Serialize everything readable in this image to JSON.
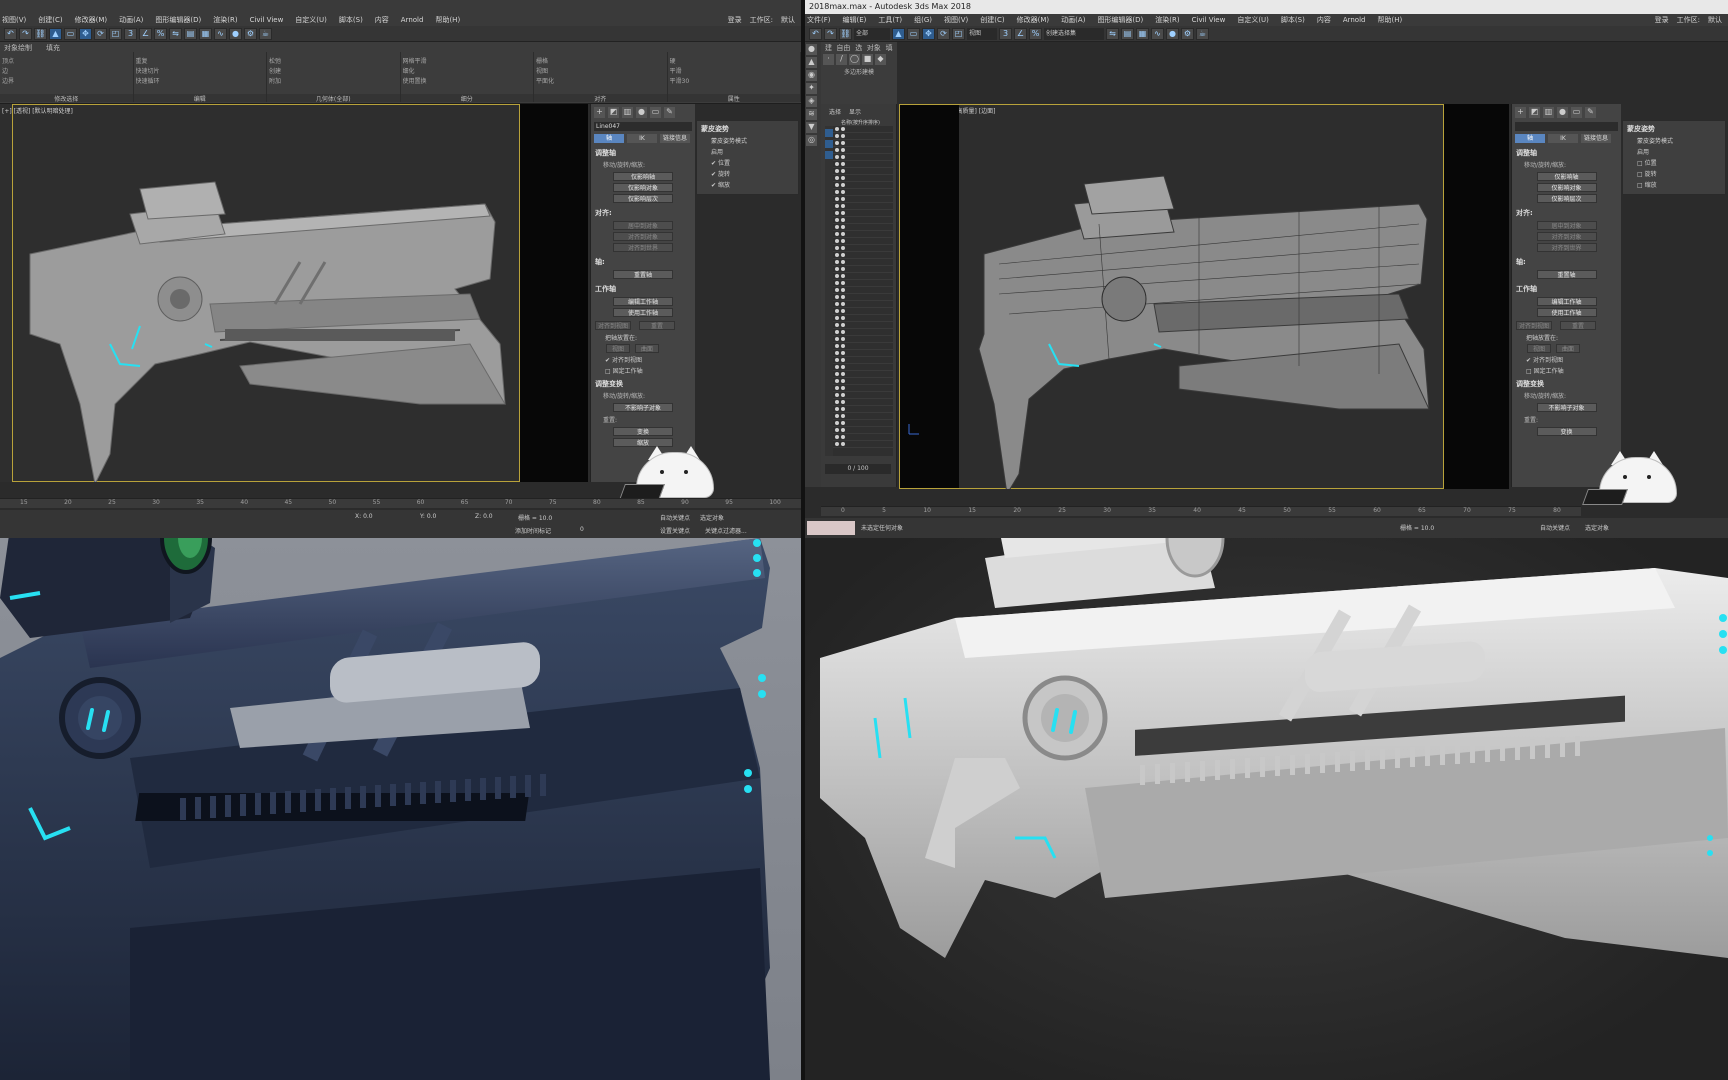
{
  "left_window": {
    "title": "",
    "menu": [
      "视图(V)",
      "创建(C)",
      "修改器(M)",
      "动画(A)",
      "图形编辑器(D)",
      "渲染(R)",
      "Civil View",
      "自定义(U)",
      "脚本(S)",
      "内容",
      "Arnold",
      "帮助(H)"
    ],
    "menu_right": {
      "login": "登录",
      "workspace": "工作区:",
      "workspace_val": "默认"
    },
    "ribbon_tabs": [
      "对象绘制",
      "填充"
    ],
    "ribbon_groups": [
      {
        "label": "修改选择",
        "rows": [
          "顶点",
          "边",
          "边界"
        ]
      },
      {
        "label": "编辑",
        "rows": [
          "重复",
          "快速切片",
          "快速循环"
        ]
      },
      {
        "label": "几何体(全部)",
        "rows": [
          "松弛",
          "创建",
          "附加"
        ]
      },
      {
        "label": "细分",
        "rows": [
          "网格平滑",
          "细化",
          "使用置换"
        ]
      },
      {
        "label": "对齐",
        "rows": [
          "栅格",
          "视图",
          "平面化"
        ]
      },
      {
        "label": "属性",
        "rows": [
          "硬",
          "平滑",
          "平滑30"
        ]
      }
    ],
    "viewport_label": "[+] [透视] [默认明暗处理]",
    "command_panel": {
      "object_name": "Line047",
      "tabs": [
        "轴",
        "IK",
        "链接信息"
      ],
      "sections": [
        {
          "title": "调整轴",
          "sub": "移动/旋转/缩放:",
          "buttons": [
            "仅影响轴",
            "仅影响对象",
            "仅影响层次"
          ]
        },
        {
          "title": "对齐:",
          "sub": "",
          "buttons": [
            "居中到对象",
            "对齐到对象",
            "对齐到世界"
          ]
        },
        {
          "title": "轴:",
          "sub": "",
          "buttons": [
            "重置轴"
          ]
        },
        {
          "title": "工作轴",
          "sub": "",
          "buttons": [
            "编辑工作轴",
            "使用工作轴"
          ]
        }
      ],
      "extra_buttons": [
        "对齐到视图",
        "重置"
      ],
      "pivot_placement": "把轴放置在:",
      "pivot_opts": [
        "视图",
        "曲面"
      ],
      "align_to_view_chk": "对齐到视图",
      "fixed_work_pivot": "固定工作轴",
      "adjust_transform": "调整变换",
      "adjust_sub": "移动/旋转/缩放:",
      "dont_affect_children": "不影响子对象",
      "reset_label": "重置:",
      "reset_btns": [
        "变换",
        "缩放"
      ],
      "skin_pose": "蒙皮姿势",
      "skin_pose_mode": "蒙皮姿势模式",
      "enable_label": "启用",
      "enable_items": [
        "位置",
        "旋转",
        "缩放"
      ]
    },
    "timeline_ticks": [
      "15",
      "20",
      "25",
      "30",
      "35",
      "40",
      "45",
      "50",
      "55",
      "60",
      "65",
      "70",
      "75",
      "80",
      "85",
      "90",
      "95",
      "100"
    ],
    "status": {
      "x_label": "X:",
      "x_val": "0.0",
      "y_label": "Y:",
      "y_val": "0.0",
      "z_label": "Z:",
      "z_val": "0.0",
      "grid": "栅格 = 10.0",
      "add_time_tag": "添加时间标记",
      "auto_key": "自动关键点",
      "selected_obj": "选定对象",
      "set_key": "设置关键点",
      "key_filter": "关键点过滤器...",
      "frame": "0"
    }
  },
  "right_window": {
    "title": "2018max.max - Autodesk 3ds Max 2018",
    "menu": [
      "文件(F)",
      "编辑(E)",
      "工具(T)",
      "组(G)",
      "视图(V)",
      "创建(C)",
      "修改器(M)",
      "动画(A)",
      "图形编辑器(D)",
      "渲染(R)",
      "Civil View",
      "自定义(U)",
      "脚本(S)",
      "内容",
      "Arnold",
      "帮助(H)"
    ],
    "menu_right": {
      "login": "登录",
      "workspace": "工作区:",
      "workspace_val": "默认"
    },
    "toolbar_sel": "全部",
    "toolbar_view": "视图",
    "toolbar_named": "创建选择集",
    "ribbon_tabs": [
      "建模",
      "自由形式",
      "选择",
      "对象绘制",
      "填充"
    ],
    "ribbon_poly": "多边形建模",
    "scene_tabs": [
      "选择",
      "显示"
    ],
    "scene_header": "名称(按升序排序)",
    "viewport_label": "[+] [Camera001] [高质量] [边面]",
    "command_panel": {
      "tabs": [
        "轴",
        "IK",
        "链接信息"
      ],
      "sections": [
        {
          "title": "调整轴",
          "sub": "移动/旋转/缩放:",
          "buttons": [
            "仅影响轴",
            "仅影响对象",
            "仅影响层次"
          ]
        },
        {
          "title": "对齐:",
          "sub": "",
          "buttons": [
            "居中到对象",
            "对齐到对象",
            "对齐到世界"
          ]
        },
        {
          "title": "轴:",
          "sub": "",
          "buttons": [
            "重置轴"
          ]
        },
        {
          "title": "工作轴",
          "sub": "",
          "buttons": [
            "编辑工作轴",
            "使用工作轴"
          ]
        }
      ],
      "extra_buttons": [
        "对齐到视图",
        "重置"
      ],
      "pivot_placement": "把轴放置在:",
      "pivot_opts": [
        "视图",
        "曲面"
      ],
      "align_to_view_chk": "对齐到视图",
      "fixed_work_pivot": "固定工作轴",
      "adjust_transform": "调整变换",
      "adjust_sub": "移动/旋转/缩放:",
      "dont_affect_children": "不影响子对象",
      "reset_label": "重置:",
      "reset_btns": [
        "变换",
        "缩放"
      ],
      "skin_pose": "蒙皮姿势",
      "skin_pose_mode": "蒙皮姿势模式",
      "enable_label": "启用",
      "enable_items": [
        "位置",
        "旋转",
        "缩放"
      ]
    },
    "scene_scroll": "0 / 100",
    "timeline_ticks": [
      "0",
      "5",
      "10",
      "15",
      "20",
      "25",
      "30",
      "35",
      "40",
      "45",
      "50",
      "55",
      "60",
      "65",
      "70",
      "75",
      "80"
    ],
    "status": {
      "none_selected": "未选定任何对象",
      "grid": "栅格 = 10.0",
      "auto_key": "自动关键点",
      "selected_obj": "选定对象"
    }
  },
  "colors": {
    "ui_bg": "#2b2b2b",
    "accent_blue": "#5a86c0",
    "viewport_frame": "#b8a23a",
    "glow_cyan": "#27e0f2",
    "dark_render_bg": "#8d9199",
    "white_render_bg": "#2a2a2a"
  }
}
